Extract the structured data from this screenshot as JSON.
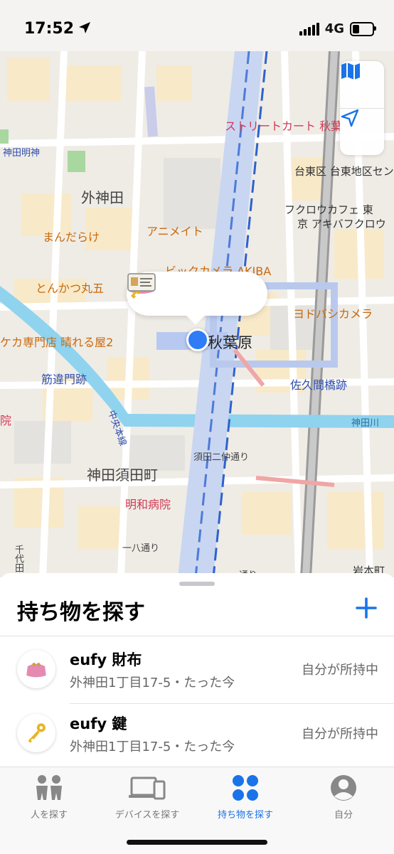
{
  "status_bar": {
    "time": "17:52",
    "network": "4G",
    "location_icon": "location-arrow-icon",
    "battery_icon": "battery-icon"
  },
  "map": {
    "labels": {
      "kanda_myojin": "神田明神",
      "sotokanda": "外神田",
      "mandarake": "まんだらけ",
      "animate": "アニメイト",
      "tonkatsu": "とんかつ丸五",
      "bic_camera": "ビックカメラ AKIBA",
      "street_kart": "ストリートカート 秋葉",
      "taito_ku": "台東区 台東地区センタ",
      "fukurou_1": "フクロウカフェ 東",
      "fukurou_2": "京 アキバフクロウ",
      "yodobashi": "ヨドバシカメラ",
      "akihabara": "秋葉原",
      "harerugaya": "ケカ専門店 晴れる屋2",
      "sujikai": "筋違門跡",
      "sakuma": "佐久間橋跡",
      "kandagawa": "神田川",
      "chuo_line": "中央本線",
      "kanda_suda_2": "須田二仲通り",
      "kanda_sudacho": "神田須田町",
      "meiwa": "明和病院",
      "ichihachi": "一八通り",
      "chiyoda": "千代田小",
      "iwamoto": "岩本町",
      "dori": "通り",
      "in": "院"
    },
    "controls": {
      "map_mode_icon": "map-icon",
      "locate_icon": "location-arrow-icon"
    },
    "bubble_items": [
      "purse-icon",
      "key-icon",
      "card-icon"
    ]
  },
  "sheet": {
    "title": "持ち物を探す",
    "add_icon": "plus-icon",
    "items": [
      {
        "name": "eufy 財布",
        "location": "外神田1丁目17-5・たった今",
        "status": "自分が所持中",
        "icon": "purse-icon"
      },
      {
        "name": "eufy 鍵",
        "location": "外神田1丁目17-5・たった今",
        "status": "自分が所持中",
        "icon": "key-icon"
      }
    ]
  },
  "tabs": [
    {
      "label": "人を探す",
      "icon": "people-icon",
      "active": false
    },
    {
      "label": "デバイスを探す",
      "icon": "devices-icon",
      "active": false
    },
    {
      "label": "持ち物を探す",
      "icon": "items-icon",
      "active": true
    },
    {
      "label": "自分",
      "icon": "person-icon",
      "active": false
    }
  ],
  "colors": {
    "accent": "#1a73e8",
    "map_bg": "#f1eee8",
    "river": "#8fd3ef",
    "railway": "#9cb4e8"
  }
}
